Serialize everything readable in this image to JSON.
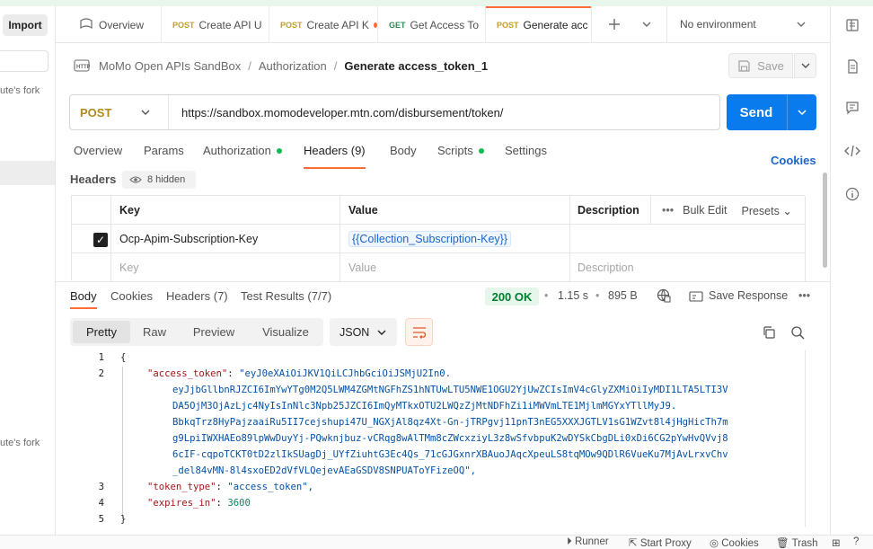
{
  "left_panel": {
    "import_label": "Import",
    "fork_text_1": "ute's fork",
    "fork_text_2": "ute's fork"
  },
  "tabs": [
    {
      "label": "Overview",
      "method": ""
    },
    {
      "label": "Create API U",
      "method": "POST"
    },
    {
      "label": "Create API K",
      "method": "POST",
      "unsaved": true
    },
    {
      "label": "Get Access To",
      "method": "GET"
    },
    {
      "label": "Generate acc",
      "method": "POST",
      "active": true
    }
  ],
  "environment": {
    "selected": "No environment"
  },
  "breadcrumb": {
    "collection": "MoMo Open APIs SandBox",
    "folder": "Authorization",
    "separator": "/",
    "current": "Generate access_token_1"
  },
  "toolbar": {
    "save_label": "Save"
  },
  "request": {
    "method": "POST",
    "url": "https://sandbox.momodeveloper.mtn.com/disbursement/token/",
    "send_label": "Send"
  },
  "request_tabs": [
    "Overview",
    "Params",
    "Authorization",
    "Headers (9)",
    "Body",
    "Scripts",
    "Settings"
  ],
  "cookies_label": "Cookies",
  "headers_section": {
    "title": "Headers",
    "hidden_label": "8 hidden",
    "columns": [
      "Key",
      "Value",
      "Description"
    ],
    "bulk_edit_label": "Bulk Edit",
    "presets_label": "Presets",
    "rows": [
      {
        "key": "Ocp-Apim-Subscription-Key",
        "value": "{{Collection_Subscription-Key}}",
        "checked": true
      }
    ],
    "placeholders": {
      "key": "Key",
      "value": "Value",
      "description": "Description"
    }
  },
  "response": {
    "tabs": [
      "Body",
      "Cookies",
      "Headers (7)",
      "Test Results (7/7)"
    ],
    "status": "200 OK",
    "time": "1.15 s",
    "size": "895 B",
    "save_response_label": "Save Response",
    "views": [
      "Pretty",
      "Raw",
      "Preview",
      "Visualize"
    ],
    "format": "JSON",
    "line_numbers": [
      "1",
      "2",
      "3",
      "4",
      "5"
    ],
    "body_lines": [
      {
        "ln": "1",
        "text": "{"
      },
      {
        "ln": "2",
        "key": "\"access_token\"",
        "value": "\"eyJ0eXAiOiJKV1QiLCJhbGciOiJSMjU2In0."
      },
      {
        "ln": "",
        "cont": "eyJjbGllbnRJZCI6ImYwYTg0M2Q5LWM4ZGMtNGFhZS1hNTUwLTU5NWE1OGU2YjUwZCIsImV4cGlyZXMiOiIyMDI1LTA5LTI3V"
      },
      {
        "ln": "",
        "cont": "DA5OjM3OjAzLjc4NyIsInNlc3Npb25JZCI6ImQyMTkxOTU2LWQzZjMtNDFhZi1iMWVmLTE1MjlmMGYxYTllMyJ9."
      },
      {
        "ln": "",
        "cont": "BbkqTrz8HyPajzaaiRu5II7cejshupi47U_NGXjAl8qz4Xt-Gn-jTRPgvj11pnT3nEG5XXXJGTLV1sG1WZvt8l4jHgHicTh7m"
      },
      {
        "ln": "",
        "cont": "g9LpiIWXHAEo89lpWwDuyYj-PQwknjbuz-vCRqg8wAlTMm8cZWcxziyL3z8wSfvbpuK2wDYSkCbgDLi0xDi6CG2pYwHvQVvj8"
      },
      {
        "ln": "",
        "cont": "6cIF-cqpoTCKT0tD2zlIkSUagDj_UYfZiuhtG3Ec4Qs_71cGJGxnrXBAuoJAqcXpeuLS8tqMOw9QDlR6VueKu7MjAvLrxvChv"
      },
      {
        "ln": "",
        "cont": "_del84vMN-8l4sxoED2dVfVLQejevAEaGSDV8SNPUAToYFizeOQ\","
      },
      {
        "ln": "3",
        "key": "\"token_type\"",
        "value": "\"access_token\","
      },
      {
        "ln": "4",
        "key": "\"expires_in\"",
        "num": "3600"
      },
      {
        "ln": "5",
        "text": "}"
      }
    ]
  },
  "footer": {
    "runner": "Runner",
    "start_proxy": "Start Proxy",
    "cookies": "Cookies",
    "trash": "Trash"
  }
}
